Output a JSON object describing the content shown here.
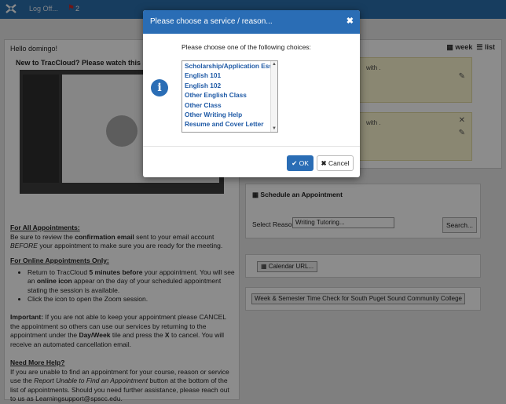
{
  "topbar": {
    "logoff_label": "Log Off...",
    "flag_count": "2"
  },
  "left": {
    "hello": "Hello domingo!",
    "new_tc": "New to TracCloud? Please watch this short vid",
    "all_heading": "For All Appointments:",
    "all_text_1": "Be sure to review the ",
    "all_text_b": "confirmation email",
    "all_text_2": " sent to your email account ",
    "all_text_i": "BEFORE",
    "all_text_3": " your appointment to make sure you are ready for the meeting.",
    "online_heading": "For Online Appointments Only:",
    "online_b1_1": "Return to TracCloud ",
    "online_b1_b": "5 minutes before",
    "online_b1_2": " your appointment. You will see an ",
    "online_b1_b2": "online icon",
    "online_b1_3": " appear on the day of your scheduled appointment stating the session is available.",
    "online_b2": "Click the icon to open the Zoom session.",
    "important_b": "Important:",
    "important_1": " If you are not able to keep your appointment please CANCEL the appointment so others can use our services by returning to the appointment under the ",
    "important_b2": "Day/Week",
    "important_2": " tile and press the ",
    "important_b3": "X",
    "important_3": " to cancel. You will receive an automated cancellation email.",
    "help_heading": "Need More Help?",
    "help_1": "If you are unable to find an appointment for your course, reason or service use the ",
    "help_i": "Report Unable to Find an Appointment",
    "help_2": " button at the bottom of the list of appointments. Should you need further assistance, please reach out to us as Learningsupport@spscc.edu."
  },
  "right": {
    "week_label": "week",
    "list_label": "list",
    "appt1_text": "with .",
    "appt2_text": "with .",
    "schedule_title": "Schedule an Appointment",
    "select_reason_label": "Select Reason",
    "select_reason_value": "Writing Tutoring...",
    "search_label": "Search...",
    "calendar_url_label": "Calendar URL...",
    "week_semester_label": "Week & Semester Time Check for South Puget Sound Community College"
  },
  "modal": {
    "title": "Please choose a service / reason...",
    "instruction": "Please choose one of the following choices:",
    "options": [
      "Scholarship/Application Essay",
      "English 101",
      "English 102",
      "Other English Class",
      "Other Class",
      "Other Writing Help",
      "Resume and Cover Letter"
    ],
    "ok_label": "OK",
    "cancel_label": "Cancel"
  }
}
